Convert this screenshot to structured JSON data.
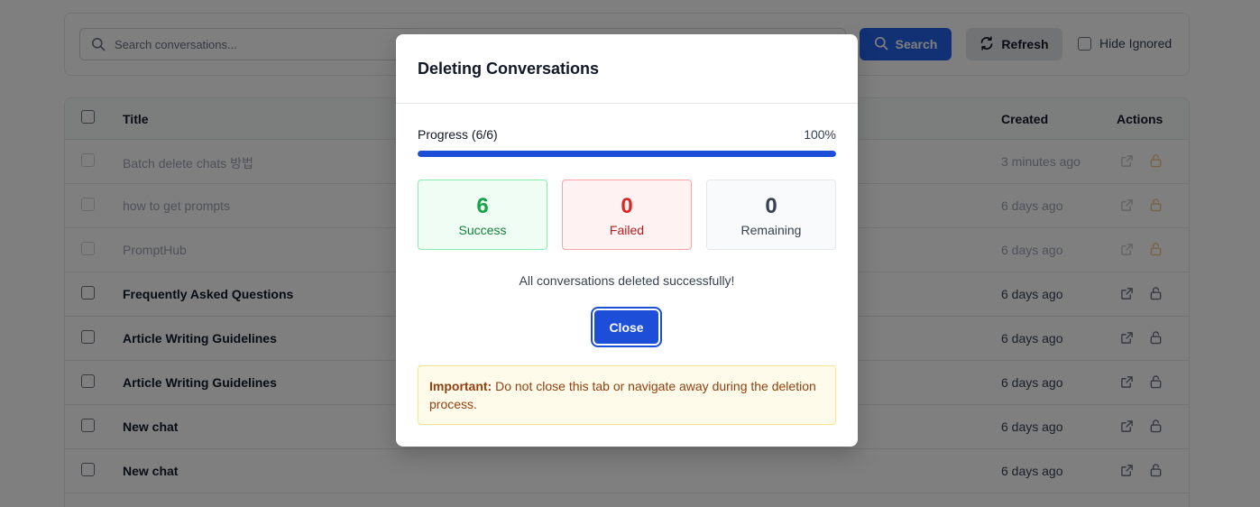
{
  "toolbar": {
    "search_placeholder": "Search conversations...",
    "search_label": "Search",
    "refresh_label": "Refresh",
    "hide_ignored_label": "Hide Ignored"
  },
  "table": {
    "headers": {
      "title": "Title",
      "created": "Created",
      "actions": "Actions"
    },
    "rows": [
      {
        "title": "Batch delete chats 방법",
        "created": "3 minutes ago",
        "dimmed": true
      },
      {
        "title": "how to get prompts",
        "created": "6 days ago",
        "dimmed": true
      },
      {
        "title": "PromptHub",
        "created": "6 days ago",
        "dimmed": true
      },
      {
        "title": "Frequently Asked Questions",
        "created": "6 days ago",
        "dimmed": false
      },
      {
        "title": "Article Writing Guidelines",
        "created": "6 days ago",
        "dimmed": false
      },
      {
        "title": "Article Writing Guidelines",
        "created": "6 days ago",
        "dimmed": false
      },
      {
        "title": "New chat",
        "created": "6 days ago",
        "dimmed": false
      },
      {
        "title": "New chat",
        "created": "6 days ago",
        "dimmed": false
      }
    ]
  },
  "modal": {
    "title": "Deleting Conversations",
    "progress_label": "Progress (6/6)",
    "progress_percent_text": "100%",
    "progress_fraction": 1.0,
    "stats": {
      "success_value": "6",
      "success_label": "Success",
      "failed_value": "0",
      "failed_label": "Failed",
      "remaining_value": "0",
      "remaining_label": "Remaining"
    },
    "done_message": "All conversations deleted successfully!",
    "close_label": "Close",
    "warning_strong": "Important:",
    "warning_text": " Do not close this tab or navigate away during the deletion process."
  },
  "colors": {
    "primary": "#1d4ed8",
    "success": "#16a34a",
    "danger": "#dc2626",
    "warning_bg": "#fffbeb",
    "lock_active": "#d97706"
  },
  "icons": {
    "search": "search-icon",
    "refresh": "refresh-icon",
    "open": "external-link-icon",
    "lock": "lock-icon"
  }
}
